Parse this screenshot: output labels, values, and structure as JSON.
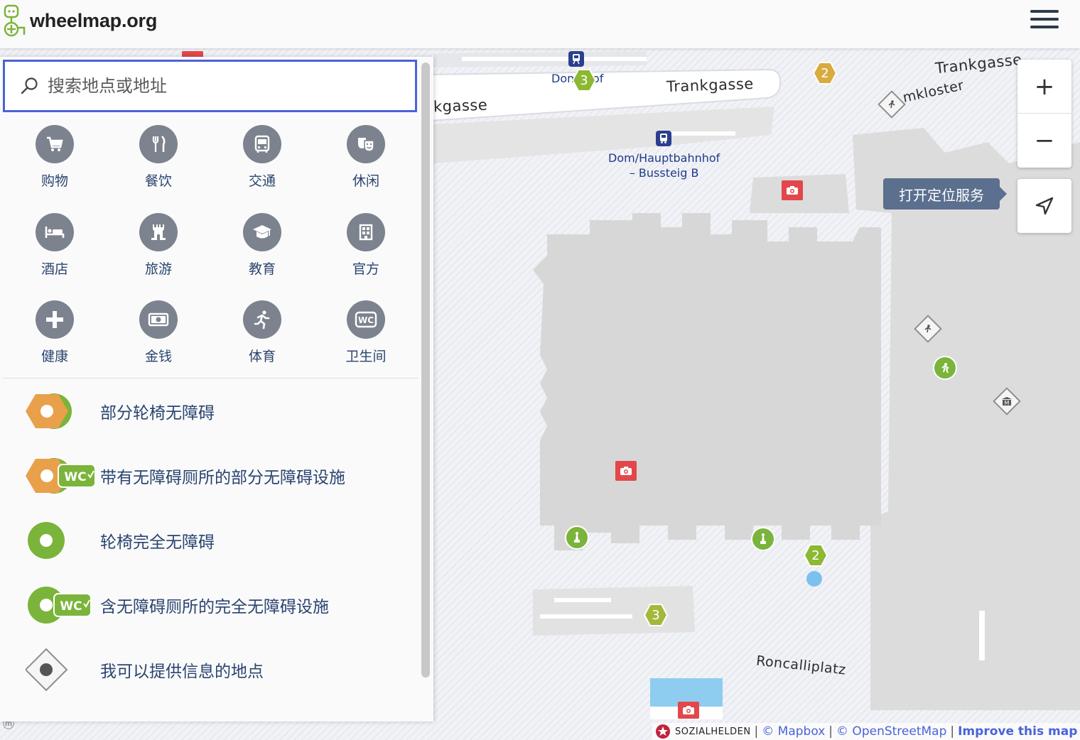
{
  "app": {
    "logo_text": "wheelmap.org"
  },
  "search": {
    "placeholder": "搜索地点或地址"
  },
  "categories": [
    {
      "label": "购物",
      "icon": "shopping-cart-icon"
    },
    {
      "label": "餐饮",
      "icon": "fork-knife-icon"
    },
    {
      "label": "交通",
      "icon": "bus-icon"
    },
    {
      "label": "休闲",
      "icon": "theater-masks-icon"
    },
    {
      "label": "酒店",
      "icon": "bed-icon"
    },
    {
      "label": "旅游",
      "icon": "tower-icon"
    },
    {
      "label": "教育",
      "icon": "graduation-cap-icon"
    },
    {
      "label": "官方",
      "icon": "building-icon"
    },
    {
      "label": "健康",
      "icon": "plus-icon"
    },
    {
      "label": "金钱",
      "icon": "banknote-icon"
    },
    {
      "label": "体育",
      "icon": "runner-icon"
    },
    {
      "label": "卫生间",
      "icon": "wc-icon"
    }
  ],
  "legend": [
    {
      "label": "部分轮椅无障碍",
      "marker": "partial"
    },
    {
      "label": "带有无障碍厕所的部分无障碍设施",
      "marker": "partial-wc",
      "badge": "WC"
    },
    {
      "label": "轮椅完全无障碍",
      "marker": "full"
    },
    {
      "label": "含无障碍厕所的完全无障碍设施",
      "marker": "full-wc",
      "badge": "WC"
    },
    {
      "label": "我可以提供信息的地点",
      "marker": "unknown"
    }
  ],
  "map": {
    "streets": {
      "trankgasse_main": "Trankgasse",
      "trankgasse_left": "kgasse",
      "trankgasse_right": "Trankgasse",
      "domkloster": "mkloster",
      "roncalliplatz": "Roncalliplatz"
    },
    "stops": {
      "dom_hbf_partial_a": "Dom",
      "dom_hbf_partial_b": "of",
      "bussteig_line1": "Dom/Hauptbahnhof",
      "bussteig_line2": "– Bussteig B"
    },
    "clusters": [
      "3",
      "2",
      "2",
      "3"
    ]
  },
  "controls": {
    "zoom_in": "+",
    "zoom_out": "−",
    "locate_tooltip": "打开定位服务"
  },
  "attribution": {
    "sozialhelden": "SOZIALHELDEN",
    "mapbox": "© Mapbox",
    "osm": "© OpenStreetMap",
    "improve": "Improve this map",
    "separator": "|"
  },
  "colors": {
    "accent": "#4a63d8",
    "partial": "#e8a04a",
    "full": "#7ab43a",
    "category_circle": "#7c838e",
    "tooltip_bg": "#5b6f8e",
    "camera_marker": "#e2474b"
  }
}
